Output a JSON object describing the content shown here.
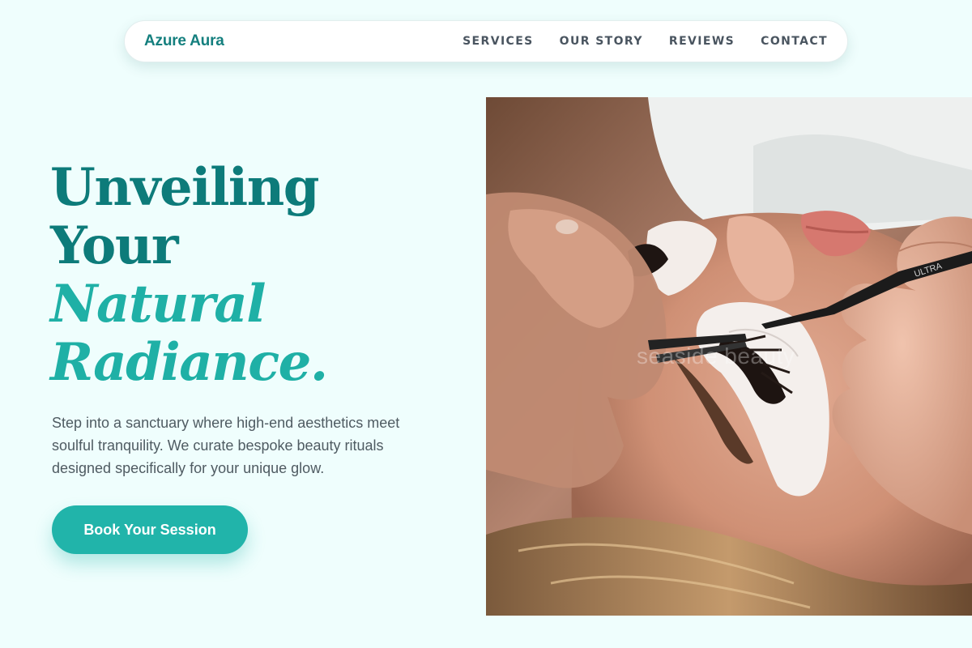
{
  "brand": {
    "name": "Azure Aura"
  },
  "nav": {
    "items": [
      {
        "label": "SERVICES"
      },
      {
        "label": "OUR STORY"
      },
      {
        "label": "REVIEWS"
      },
      {
        "label": "CONTACT"
      }
    ]
  },
  "hero": {
    "title_line1": "Unveiling",
    "title_line2": "Your",
    "title_accent1": "Natural",
    "title_accent2": "Radiance.",
    "description": "Step into a sanctuary where high-end aesthetics meet soulful tranquility. We curate bespoke beauty rituals designed specifically for your unique glow.",
    "cta_label": "Book Your Session"
  },
  "image": {
    "subject": "eyelash extension application close-up",
    "watermark": "seaside beauty"
  },
  "colors": {
    "background": "#effefd",
    "brand": "#147f7e",
    "title": "#0d7b7a",
    "accent": "#1fb0a6",
    "cta": "#21b4aa"
  }
}
